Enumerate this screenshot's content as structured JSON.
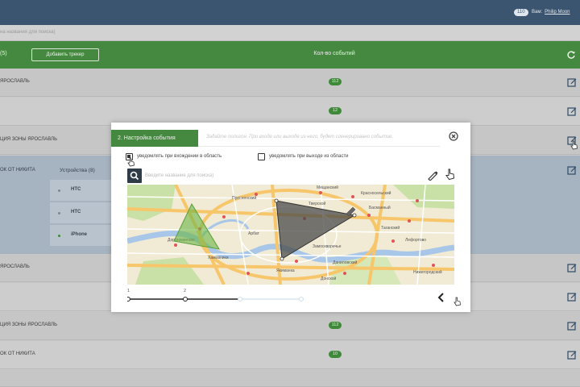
{
  "header": {
    "badge": "110",
    "user_prefix": "Вам:",
    "user_name": "Philip Moon"
  },
  "search": {
    "placeholder": "на названия для поиска)"
  },
  "toolbar": {
    "count_label": "(5)",
    "add_button": "Добавить трекер",
    "events_header": "Кол-во событий",
    "refresh_icon": "refresh-icon"
  },
  "rows": [
    {
      "name": "ЯРОСЛАВЛЬ",
      "events": "112"
    },
    {
      "name": "",
      "events": "12"
    },
    {
      "name": "ЦИЯ ЗОНЫ ЯРОСЛАВЛЬ",
      "events": ""
    },
    {
      "name": "ЯРОСЛАВЛЬ",
      "events": ""
    },
    {
      "name": "",
      "events": ""
    },
    {
      "name": "ЦИЯ ЗОНЫ ЯРОСЛАВЛЬ",
      "events": "112"
    },
    {
      "name": "ОК ОТ НИКИТА",
      "events": "10"
    }
  ],
  "expanded_row": {
    "name": "ОК ОТ НИКИТА",
    "devices_header": "Устройства (8)",
    "devices": [
      {
        "name": "HTC",
        "active": false
      },
      {
        "name": "HTC",
        "active": false
      },
      {
        "name": "iPhone",
        "active": true
      }
    ]
  },
  "modal": {
    "step_tab": "2. Настройка события",
    "hint": "Задайте полигон. При входе или выходе из него, будет сгенерировано событие.",
    "notify_enter": "уведомлять при вхождении в область",
    "notify_exit": "уведомлять при выходе из области",
    "notify_enter_checked": true,
    "notify_exit_checked": false,
    "address_placeholder": "Введите название для поиска)",
    "steps": [
      "1",
      "2"
    ],
    "map_labels": [
      "Красносельский",
      "Пресненский",
      "Тверской",
      "Басманный",
      "Мещанский",
      "Хамовники",
      "Якиманка",
      "Таганский",
      "Замоскворечье",
      "Дорогомилово",
      "Арбат",
      "Даниловский",
      "Лефортово",
      "Донской",
      "Нижегородский"
    ],
    "colors": {
      "accent": "#45883f",
      "polygon_green": "#6bb544",
      "polygon_dark": "#4a4a4a"
    }
  }
}
